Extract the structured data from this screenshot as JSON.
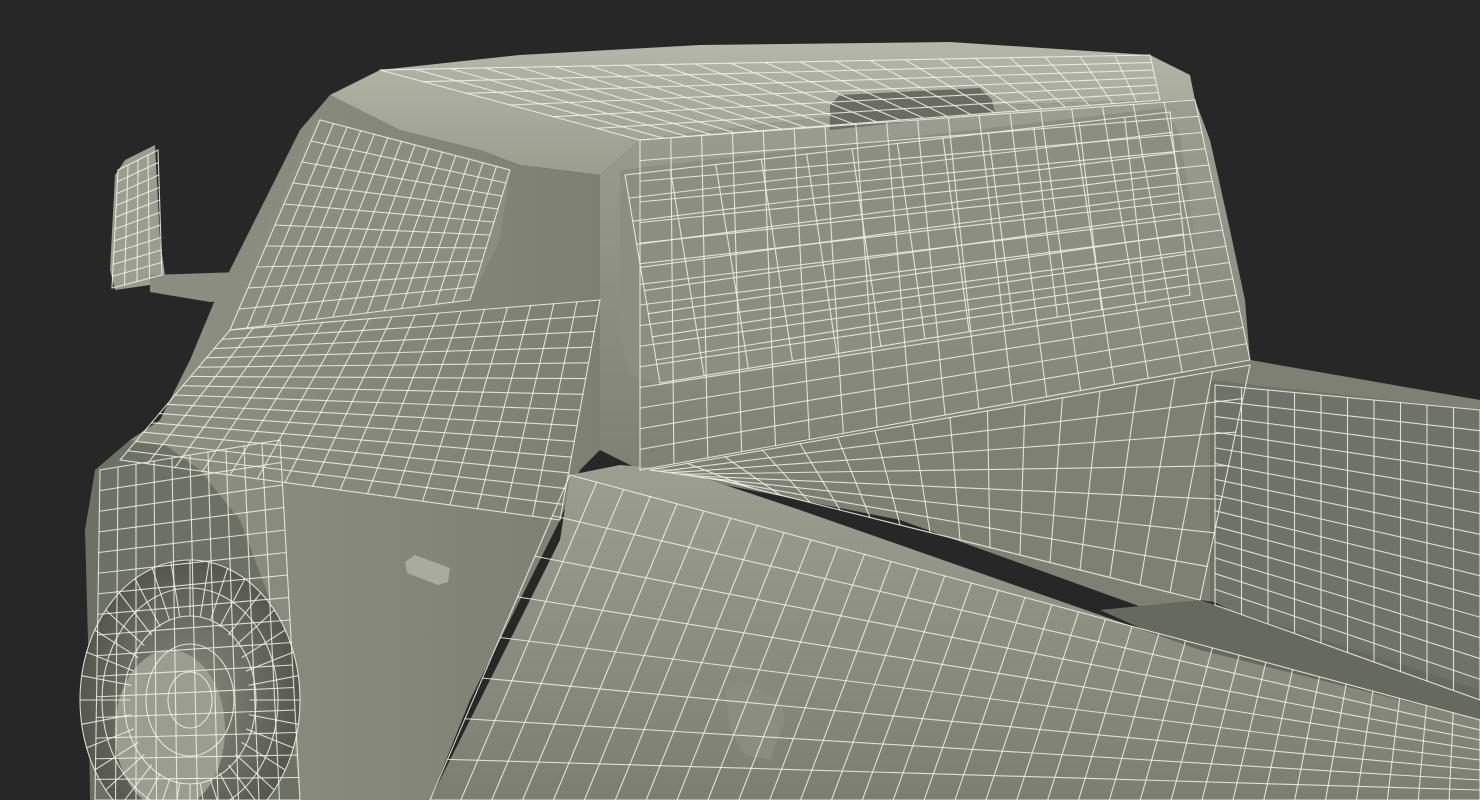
{
  "scene": {
    "subject": "wireframe-pickup-truck",
    "colors": {
      "background": "#262726",
      "surface_light": "#a6a99b",
      "surface_mid": "#8e9183",
      "surface_dark": "#6d7064",
      "surface_shadow": "#55574e",
      "wire": "#f2f2e9"
    }
  }
}
